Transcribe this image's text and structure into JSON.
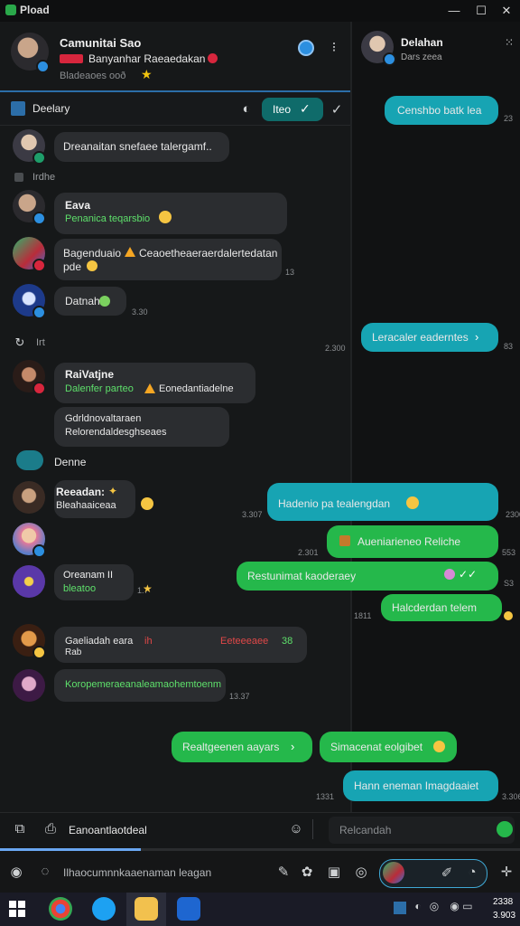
{
  "window": {
    "title": "Pload",
    "minimize": "—",
    "maximize": "☐",
    "close": "✕"
  },
  "chat_header": {
    "name": "Camunitai Sao",
    "status_line": "Banyanhar Raeaedakan",
    "sub_line": "Bladeaoes ooð",
    "star": "★"
  },
  "right_header": {
    "name": "Delahan",
    "sub": "Dars zeea"
  },
  "pinned": {
    "label": "Deelary",
    "chip_label": "Iteo"
  },
  "sections": {
    "s1": "Irdhe",
    "s2": "Irt"
  },
  "messages_in": [
    {
      "text": "Dreanaitan snefaee talergamf.."
    },
    {
      "name": "Eava",
      "sub": "Penanica teqarsbio"
    },
    {
      "text1": "Bagenduaio",
      "text2": "Ceaoetheaeraerdalertedatan",
      "text3": "pde"
    },
    {
      "text": "Datnah",
      "time": "3.30"
    },
    {
      "name": "RaiVatjne",
      "sub": "Dalenfer parteo",
      "sub2": "Eonedantiadelne"
    },
    {
      "text1": "Gdrldnovaltaraen",
      "text2": "Relorendaldesghseaes"
    },
    {
      "text": "Denne"
    },
    {
      "name": "Reeadan:",
      "sub": "Bleahaaiceaa"
    },
    {
      "name": "Oreanam II",
      "sub": "bleatoo",
      "time": "1.7"
    },
    {
      "text1": "Gaeliadah eara",
      "text2": "Rab",
      "red1": "ih",
      "red2": "Eeteeeaee",
      "num": "38"
    },
    {
      "text": "Koropemeraeanaleamaohemtoenm",
      "time": "13.37"
    }
  ],
  "messages_out": [
    {
      "text": "Censhbo batk lea",
      "time": "23"
    },
    {
      "text": "Leracaler eaderntes",
      "time": "83"
    },
    {
      "text": "Hadenio pa tealengdan",
      "time": "2300"
    },
    {
      "text": "Aueniarieneo Reliche",
      "time": "553"
    },
    {
      "text": "Restunimat kaoderaey",
      "time": "S3"
    },
    {
      "text": "Halcderdan telem",
      "time": "1811"
    },
    {
      "text": "Realtgeenen aayars"
    },
    {
      "text": "Simacenat eolgibet"
    },
    {
      "text": "Hann eneman Imagdaaiet",
      "time": "1331"
    }
  ],
  "times": {
    "t1": "13",
    "t2": "3.307",
    "t3": "2.301",
    "t4": "2.300",
    "t5": "3.306"
  },
  "compose": {
    "left_label": "Eanoantlaotdeal",
    "placeholder": "Relcandah"
  },
  "bottom": {
    "placeholder": "Ilhaocumnnkaaenaman leagan"
  },
  "progress": {
    "fraction": 0.27
  },
  "taskbar": {
    "clock_time": "2338",
    "clock_date": "3.903"
  },
  "colors": {
    "teal": "#17a4b3",
    "green": "#25b84b",
    "accent": "#6aa7f2"
  }
}
